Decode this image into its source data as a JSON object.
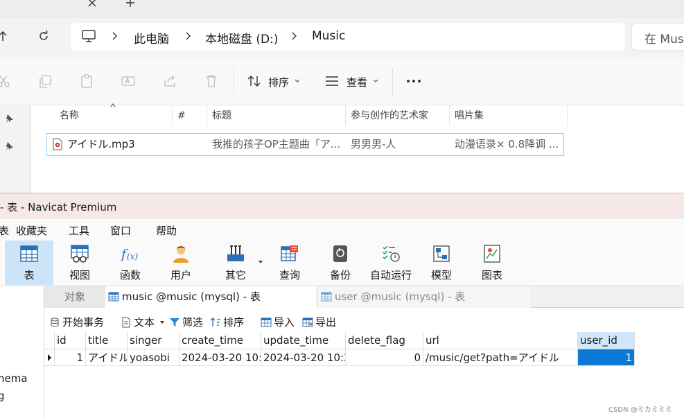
{
  "explorer": {
    "breadcrumb": [
      "此电脑",
      "本地磁盘 (D:)",
      "Music"
    ],
    "search_placeholder": "在 Music",
    "sort_label": "排序",
    "view_label": "查看",
    "columns": [
      "名称",
      "#",
      "标题",
      "参与创作的艺术家",
      "唱片集"
    ],
    "file": {
      "name": "アイドル.mp3",
      "title": "我推的孩子OP主题曲「ア...",
      "artist": "男男男-人",
      "album": "动漫语录× 0.8降调 ..."
    }
  },
  "navicat": {
    "window_title": "- 表 - Navicat Premium",
    "menu": [
      "表",
      "收藏夹",
      "工具",
      "窗口",
      "帮助"
    ],
    "toolbar": [
      {
        "label": "表",
        "icon": "table-icon",
        "active": true
      },
      {
        "label": "视图",
        "icon": "view-icon"
      },
      {
        "label": "函数",
        "icon": "function-icon"
      },
      {
        "label": "用户",
        "icon": "user-icon"
      },
      {
        "label": "其它",
        "icon": "tools-icon"
      },
      {
        "label": "查询",
        "icon": "query-icon"
      },
      {
        "label": "备份",
        "icon": "backup-icon"
      },
      {
        "label": "自动运行",
        "icon": "schedule-icon"
      },
      {
        "label": "模型",
        "icon": "model-icon"
      },
      {
        "label": "图表",
        "icon": "chart-icon"
      }
    ],
    "tree_items": [
      "hema",
      "g"
    ],
    "tabs": [
      {
        "label": "对象"
      },
      {
        "label": "music @music (mysql) - 表"
      },
      {
        "label": "user @music (mysql) - 表"
      }
    ],
    "subtoolbar": [
      "开始事务",
      "文本",
      "筛选",
      "排序",
      "导入",
      "导出"
    ],
    "grid": {
      "columns": [
        "id",
        "title",
        "singer",
        "create_time",
        "update_time",
        "delete_flag",
        "url",
        "user_id"
      ],
      "rows": [
        [
          "1",
          "アイドル",
          "yoasobi",
          "2024-03-20 10:2",
          "2024-03-20 10:2",
          "0",
          "/music/get?path=アイドル",
          "1"
        ]
      ]
    }
  },
  "watermark": "CSDN @ミカミミミ"
}
